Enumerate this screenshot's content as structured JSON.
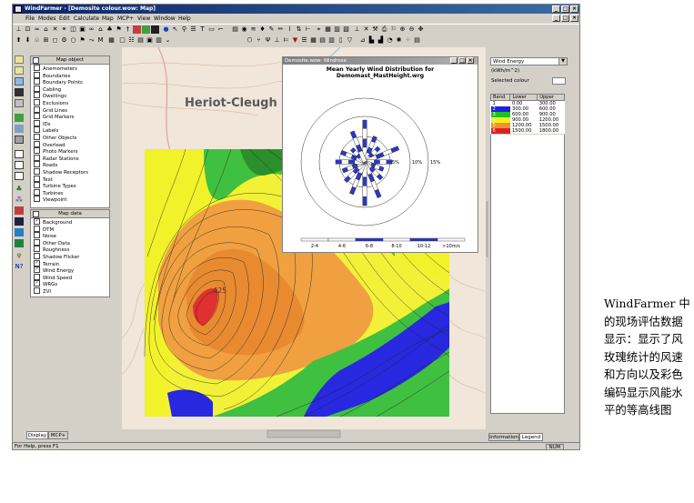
{
  "window": {
    "title": "WindFarmer - [Demosite colour.wow: Map]",
    "controls": [
      "_",
      "□",
      "×"
    ]
  },
  "menu": [
    "File",
    "Modes",
    "Edit",
    "Calculate",
    "Map",
    "MCP+",
    "View",
    "Window",
    "Help"
  ],
  "map_object_panel": {
    "header": "Map object",
    "items": [
      "Anemometers",
      "Boundaries",
      "Boundary Points",
      "Cabling",
      "Dwellings",
      "Exclusions",
      "Grid Lines",
      "Grid Markers",
      "IDs",
      "Labels",
      "Other Objects",
      "Overlead",
      "Photo Markers",
      "Radar Stations",
      "Roads",
      "Shadow Receptors",
      "Text",
      "Turbine Types",
      "Turbines",
      "Viewpoint"
    ]
  },
  "map_data_panel": {
    "header": "Map data",
    "items": [
      {
        "label": "Background",
        "checked": true
      },
      {
        "label": "DTM",
        "checked": false
      },
      {
        "label": "Noise",
        "checked": false
      },
      {
        "label": "Other Data",
        "checked": false
      },
      {
        "label": "Roughness",
        "checked": false
      },
      {
        "label": "Shadow Flicker",
        "checked": false
      },
      {
        "label": "Terrain",
        "checked": true
      },
      {
        "label": "Wind Energy",
        "checked": true
      },
      {
        "label": "Wind Speed",
        "checked": false
      },
      {
        "label": "WRGs",
        "checked": true
      },
      {
        "label": "ZVI",
        "checked": false
      }
    ]
  },
  "left_tabs": [
    "Display",
    "MCP+"
  ],
  "map": {
    "place_name": "Heriot-Cleugh",
    "peak_label": "425"
  },
  "windrose": {
    "window_title": "Demosite.wow: Windrose",
    "title_line1": "Mean Yearly Wind Distribution for",
    "title_line2": "Demomast_MastHeight.wrg",
    "ring_labels": [
      "5%",
      "10%",
      "15%"
    ],
    "speed_bins": [
      "2-4",
      "4-6",
      "6-8",
      "8-10",
      "10-12",
      ">10m/s"
    ],
    "speed_colors": [
      "#ffffff",
      "#ffffff",
      "#2d37c8",
      "#ffffff",
      "#2d37c8",
      "#ffffff"
    ]
  },
  "legend_panel": {
    "dropdown_value": "Wind Energy",
    "unit": "(kWh/m^2)",
    "selected_colour_label": "Selected colour",
    "columns": [
      "Band",
      "Lower",
      "Upper"
    ],
    "bands": [
      {
        "band": "1",
        "lower": "0.00",
        "upper": "300.00",
        "color": "#ffffff"
      },
      {
        "band": "2",
        "lower": "300.00",
        "upper": "600.00",
        "color": "#2020e0"
      },
      {
        "band": "3",
        "lower": "600.00",
        "upper": "900.00",
        "color": "#20c020"
      },
      {
        "band": "4",
        "lower": "900.00",
        "upper": "1200.00",
        "color": "#f0f020"
      },
      {
        "band": "5",
        "lower": "1200.00",
        "upper": "1500.00",
        "color": "#f09030"
      },
      {
        "band": "6",
        "lower": "1500.00",
        "upper": "1800.00",
        "color": "#e02020"
      }
    ],
    "tabs": [
      "Information",
      "Legend"
    ]
  },
  "status": {
    "help_text": "For Help, press F1",
    "num_indicator": "NUM"
  },
  "caption": "WindFarmer 中的现场评估数据显示：显示了风玫瑰统计的风速和方向以及彩色编码显示风能水平的等高线图"
}
